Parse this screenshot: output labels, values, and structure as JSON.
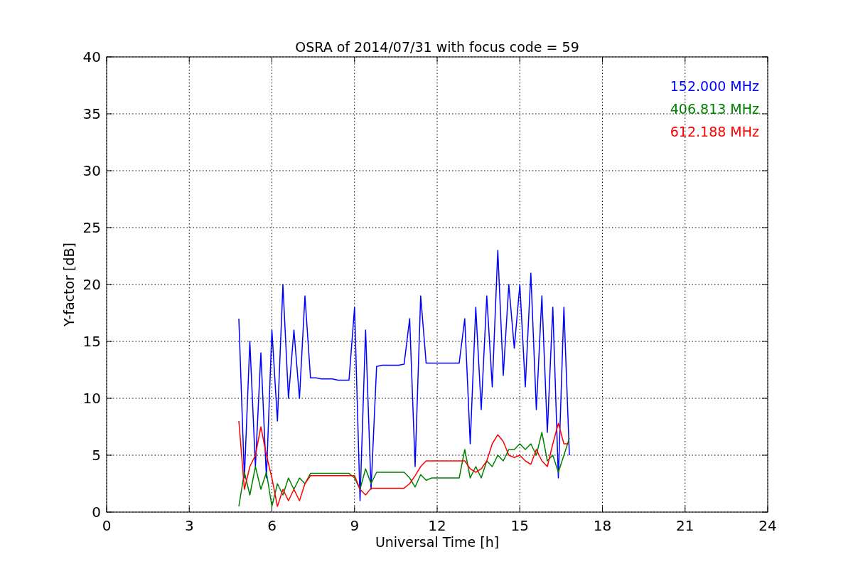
{
  "chart_data": {
    "type": "line",
    "title": "OSRA of 2014/07/31 with focus code = 59",
    "xlabel": "Universal Time [h]",
    "ylabel": "Y-factor [dB]",
    "x": [
      4.8,
      5.0,
      5.2,
      5.4,
      5.6,
      5.8,
      6.0,
      6.2,
      6.4,
      6.6,
      6.8,
      7.0,
      7.2,
      7.4,
      7.6,
      7.8,
      8.0,
      8.2,
      8.4,
      8.6,
      8.8,
      9.0,
      9.2,
      9.4,
      9.6,
      9.8,
      10.0,
      10.2,
      10.4,
      10.6,
      10.8,
      11.0,
      11.2,
      11.4,
      11.6,
      11.8,
      12.0,
      12.2,
      12.4,
      12.6,
      12.8,
      13.0,
      13.2,
      13.4,
      13.6,
      13.8,
      14.0,
      14.2,
      14.4,
      14.6,
      14.8,
      15.0,
      15.2,
      15.4,
      15.6,
      15.8,
      16.0,
      16.2,
      16.4,
      16.6,
      16.8
    ],
    "series": [
      {
        "name": "152.000 MHz",
        "color": "#0000ff",
        "values": [
          17,
          3,
          15,
          4,
          14,
          3,
          16,
          8,
          20,
          10,
          16,
          10,
          19,
          11.8,
          11.8,
          11.7,
          11.7,
          11.7,
          11.6,
          11.6,
          11.6,
          18,
          1,
          16,
          2,
          12.8,
          12.9,
          12.9,
          12.9,
          12.9,
          13,
          17,
          4,
          19,
          13.1,
          13.1,
          13.1,
          13.1,
          13.1,
          13.1,
          13.1,
          17,
          6,
          18,
          9,
          19,
          11,
          23,
          12,
          20,
          14.4,
          20,
          11,
          21,
          9,
          19,
          7,
          18,
          3,
          18,
          5
        ]
      },
      {
        "name": "406.813 MHz",
        "color": "#008000",
        "values": [
          0.5,
          3.5,
          1.5,
          4,
          2,
          3.5,
          0.5,
          2.5,
          1.5,
          3,
          2,
          3,
          2.5,
          3.4,
          3.4,
          3.4,
          3.4,
          3.4,
          3.4,
          3.4,
          3.4,
          3,
          2,
          3.8,
          2.5,
          3.5,
          3.5,
          3.5,
          3.5,
          3.5,
          3.5,
          3,
          2.2,
          3.3,
          2.8,
          3,
          3,
          3,
          3,
          3,
          3,
          5.5,
          3,
          4,
          3,
          4.5,
          4,
          5,
          4.5,
          5.5,
          5.5,
          6,
          5.5,
          6,
          5,
          7,
          4.5,
          5,
          3.5,
          5,
          6.5
        ]
      },
      {
        "name": "612.188 MHz",
        "color": "#ff0000",
        "values": [
          8,
          2,
          4,
          5,
          7.5,
          5,
          3,
          0.5,
          2,
          1,
          2,
          1,
          2.5,
          3.2,
          3.2,
          3.2,
          3.2,
          3.2,
          3.2,
          3.2,
          3.2,
          3.2,
          2,
          1.5,
          2.1,
          2.1,
          2.1,
          2.1,
          2.1,
          2.1,
          2.1,
          2.5,
          3.2,
          4,
          4.5,
          4.5,
          4.5,
          4.5,
          4.5,
          4.5,
          4.5,
          4.5,
          3.8,
          3.5,
          3.8,
          4.5,
          6,
          6.8,
          6.2,
          5,
          4.8,
          5,
          4.5,
          4.2,
          5.5,
          4.5,
          4,
          6,
          7.8,
          6,
          6
        ]
      }
    ],
    "xlim": [
      0,
      24
    ],
    "ylim": [
      0,
      40
    ],
    "xticks": [
      0,
      3,
      6,
      9,
      12,
      15,
      18,
      21,
      24
    ],
    "yticks": [
      0,
      5,
      10,
      15,
      20,
      25,
      30,
      35,
      40
    ],
    "grid": true
  }
}
